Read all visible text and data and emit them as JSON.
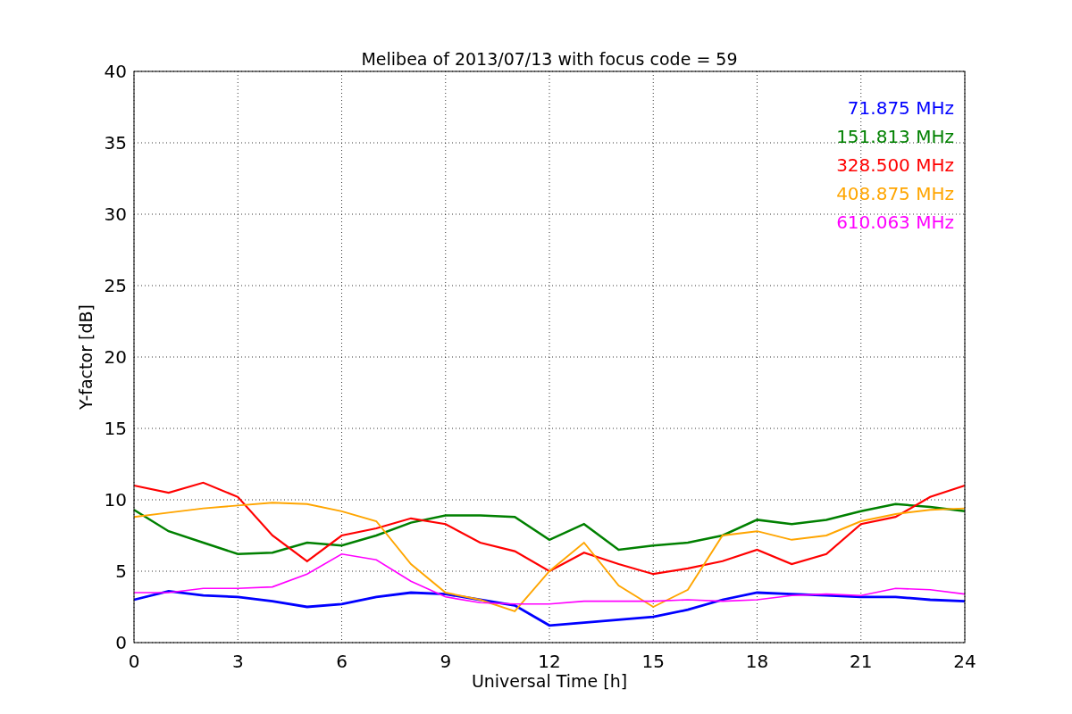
{
  "figure": {
    "chart_data": {
      "type": "line",
      "title": "Melibea of 2013/07/13 with focus code = 59",
      "xlabel": "Universal Time [h]",
      "ylabel": "Y-factor [dB]",
      "x": [
        0,
        1,
        2,
        3,
        4,
        5,
        6,
        7,
        8,
        9,
        10,
        11,
        12,
        13,
        14,
        15,
        16,
        17,
        18,
        19,
        20,
        21,
        22,
        23,
        24
      ],
      "series": [
        {
          "name": "71.875 MHz",
          "color": "#0000ff",
          "values": [
            3.0,
            3.6,
            3.3,
            3.2,
            2.9,
            2.5,
            2.7,
            3.2,
            3.5,
            3.4,
            3.0,
            2.6,
            1.2,
            1.4,
            1.6,
            1.8,
            2.3,
            3.0,
            3.5,
            3.4,
            3.3,
            3.2,
            3.2,
            3.0,
            2.9
          ]
        },
        {
          "name": "151.813 MHz",
          "color": "#008000",
          "values": [
            9.3,
            7.8,
            7.0,
            6.2,
            6.3,
            7.0,
            6.8,
            7.5,
            8.4,
            8.9,
            8.9,
            8.8,
            7.2,
            8.3,
            6.5,
            6.8,
            7.0,
            7.5,
            8.6,
            8.3,
            8.6,
            9.2,
            9.7,
            9.5,
            9.2
          ]
        },
        {
          "name": "328.500 MHz",
          "color": "#ff0000",
          "values": [
            11.0,
            10.5,
            11.2,
            10.2,
            7.5,
            5.7,
            7.5,
            8.0,
            8.7,
            8.3,
            7.0,
            6.4,
            5.0,
            6.3,
            5.5,
            4.8,
            5.2,
            5.7,
            6.5,
            5.5,
            6.2,
            8.3,
            8.8,
            10.2,
            11.0
          ]
        },
        {
          "name": "408.875 MHz",
          "color": "#ffa500",
          "values": [
            8.8,
            9.1,
            9.4,
            9.6,
            9.8,
            9.7,
            9.2,
            8.5,
            5.5,
            3.5,
            3.0,
            2.2,
            5.0,
            7.0,
            4.0,
            2.5,
            3.7,
            7.5,
            7.8,
            7.2,
            7.5,
            8.5,
            9.0,
            9.3,
            9.4
          ]
        },
        {
          "name": "610.063 MHz",
          "color": "#ff00ff",
          "values": [
            3.5,
            3.5,
            3.8,
            3.8,
            3.9,
            4.8,
            6.2,
            5.8,
            4.3,
            3.2,
            2.8,
            2.7,
            2.7,
            2.9,
            2.9,
            2.9,
            3.0,
            2.9,
            3.0,
            3.3,
            3.4,
            3.3,
            3.8,
            3.7,
            3.4
          ]
        }
      ],
      "grid": true,
      "xlim": [
        0,
        24
      ],
      "ylim": [
        0,
        40
      ],
      "xticks": [
        0,
        3,
        6,
        9,
        12,
        15,
        18,
        21,
        24
      ],
      "yticks": [
        0,
        5,
        10,
        15,
        20,
        25,
        30,
        35,
        40
      ]
    }
  }
}
